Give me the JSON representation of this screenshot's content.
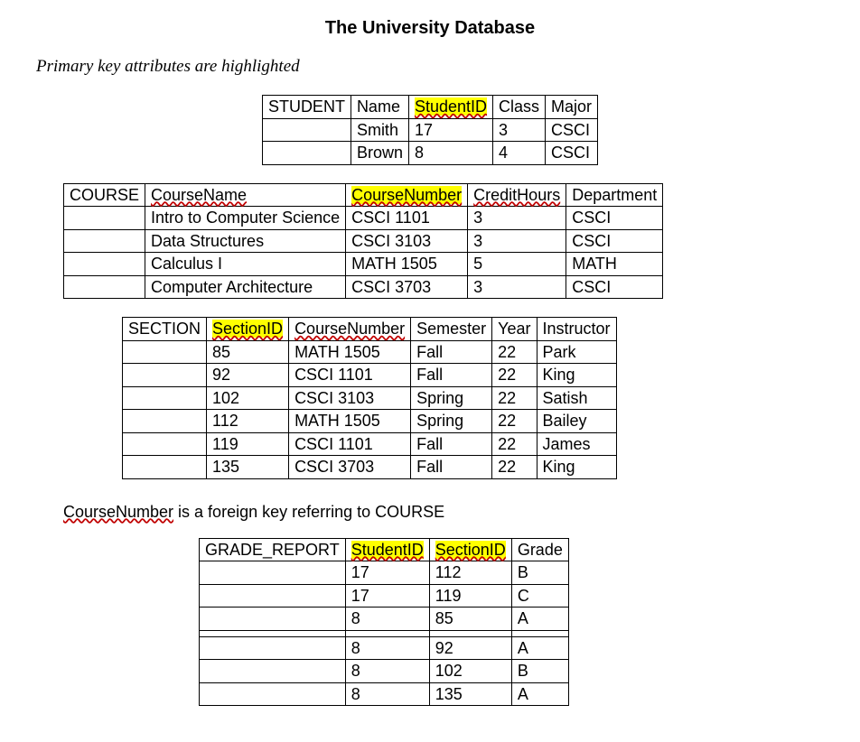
{
  "title": "The University Database",
  "subtitle": "Primary key attributes are highlighted",
  "fk_note_prefix": "CourseNumber",
  "fk_note_rest": " is a foreign key referring to COURSE",
  "student": {
    "name": "STUDENT",
    "headers": [
      "Name",
      "StudentID",
      "Class",
      "Major"
    ],
    "pk_index": 1,
    "spell_indices": [
      1
    ],
    "rows": [
      [
        "Smith",
        "17",
        "3",
        "CSCI"
      ],
      [
        "Brown",
        "8",
        "4",
        "CSCI"
      ]
    ]
  },
  "course": {
    "name": "COURSE",
    "headers": [
      "CourseName",
      "CourseNumber",
      "CreditHours",
      "Department"
    ],
    "pk_index": 1,
    "spell_indices": [
      0,
      1,
      2
    ],
    "rows": [
      [
        "Intro to Computer Science",
        "CSCI 1101",
        "3",
        "CSCI"
      ],
      [
        "Data Structures",
        "CSCI 3103",
        "3",
        "CSCI"
      ],
      [
        "Calculus I",
        "MATH 1505",
        "5",
        "MATH"
      ],
      [
        "Computer Architecture",
        "CSCI 3703",
        "3",
        "CSCI"
      ]
    ]
  },
  "section": {
    "name": "SECTION",
    "headers": [
      "SectionID",
      "CourseNumber",
      "Semester",
      "Year",
      "Instructor"
    ],
    "pk_index": 0,
    "spell_indices": [
      0,
      1
    ],
    "rows": [
      [
        "85",
        "MATH 1505",
        "Fall",
        "22",
        "Park"
      ],
      [
        "92",
        "CSCI 1101",
        "Fall",
        "22",
        "King"
      ],
      [
        "102",
        "CSCI 3103",
        "Spring",
        "22",
        "Satish"
      ],
      [
        "112",
        "MATH 1505",
        "Spring",
        "22",
        "Bailey"
      ],
      [
        "119",
        "CSCI 1101",
        "Fall",
        "22",
        "James"
      ],
      [
        "135",
        "CSCI 3703",
        "Fall",
        "22",
        "King"
      ]
    ]
  },
  "grade_report": {
    "name": "GRADE_REPORT",
    "headers": [
      "StudentID",
      "SectionID",
      "Grade"
    ],
    "pk_indices": [
      0,
      1
    ],
    "spell_indices": [
      0,
      1
    ],
    "gap_after_row": 2,
    "rows": [
      [
        "17",
        "112",
        "B"
      ],
      [
        "17",
        "119",
        "C"
      ],
      [
        "8",
        "85",
        "A"
      ],
      [
        "8",
        "92",
        "A"
      ],
      [
        "8",
        "102",
        "B"
      ],
      [
        "8",
        "135",
        "A"
      ]
    ]
  }
}
